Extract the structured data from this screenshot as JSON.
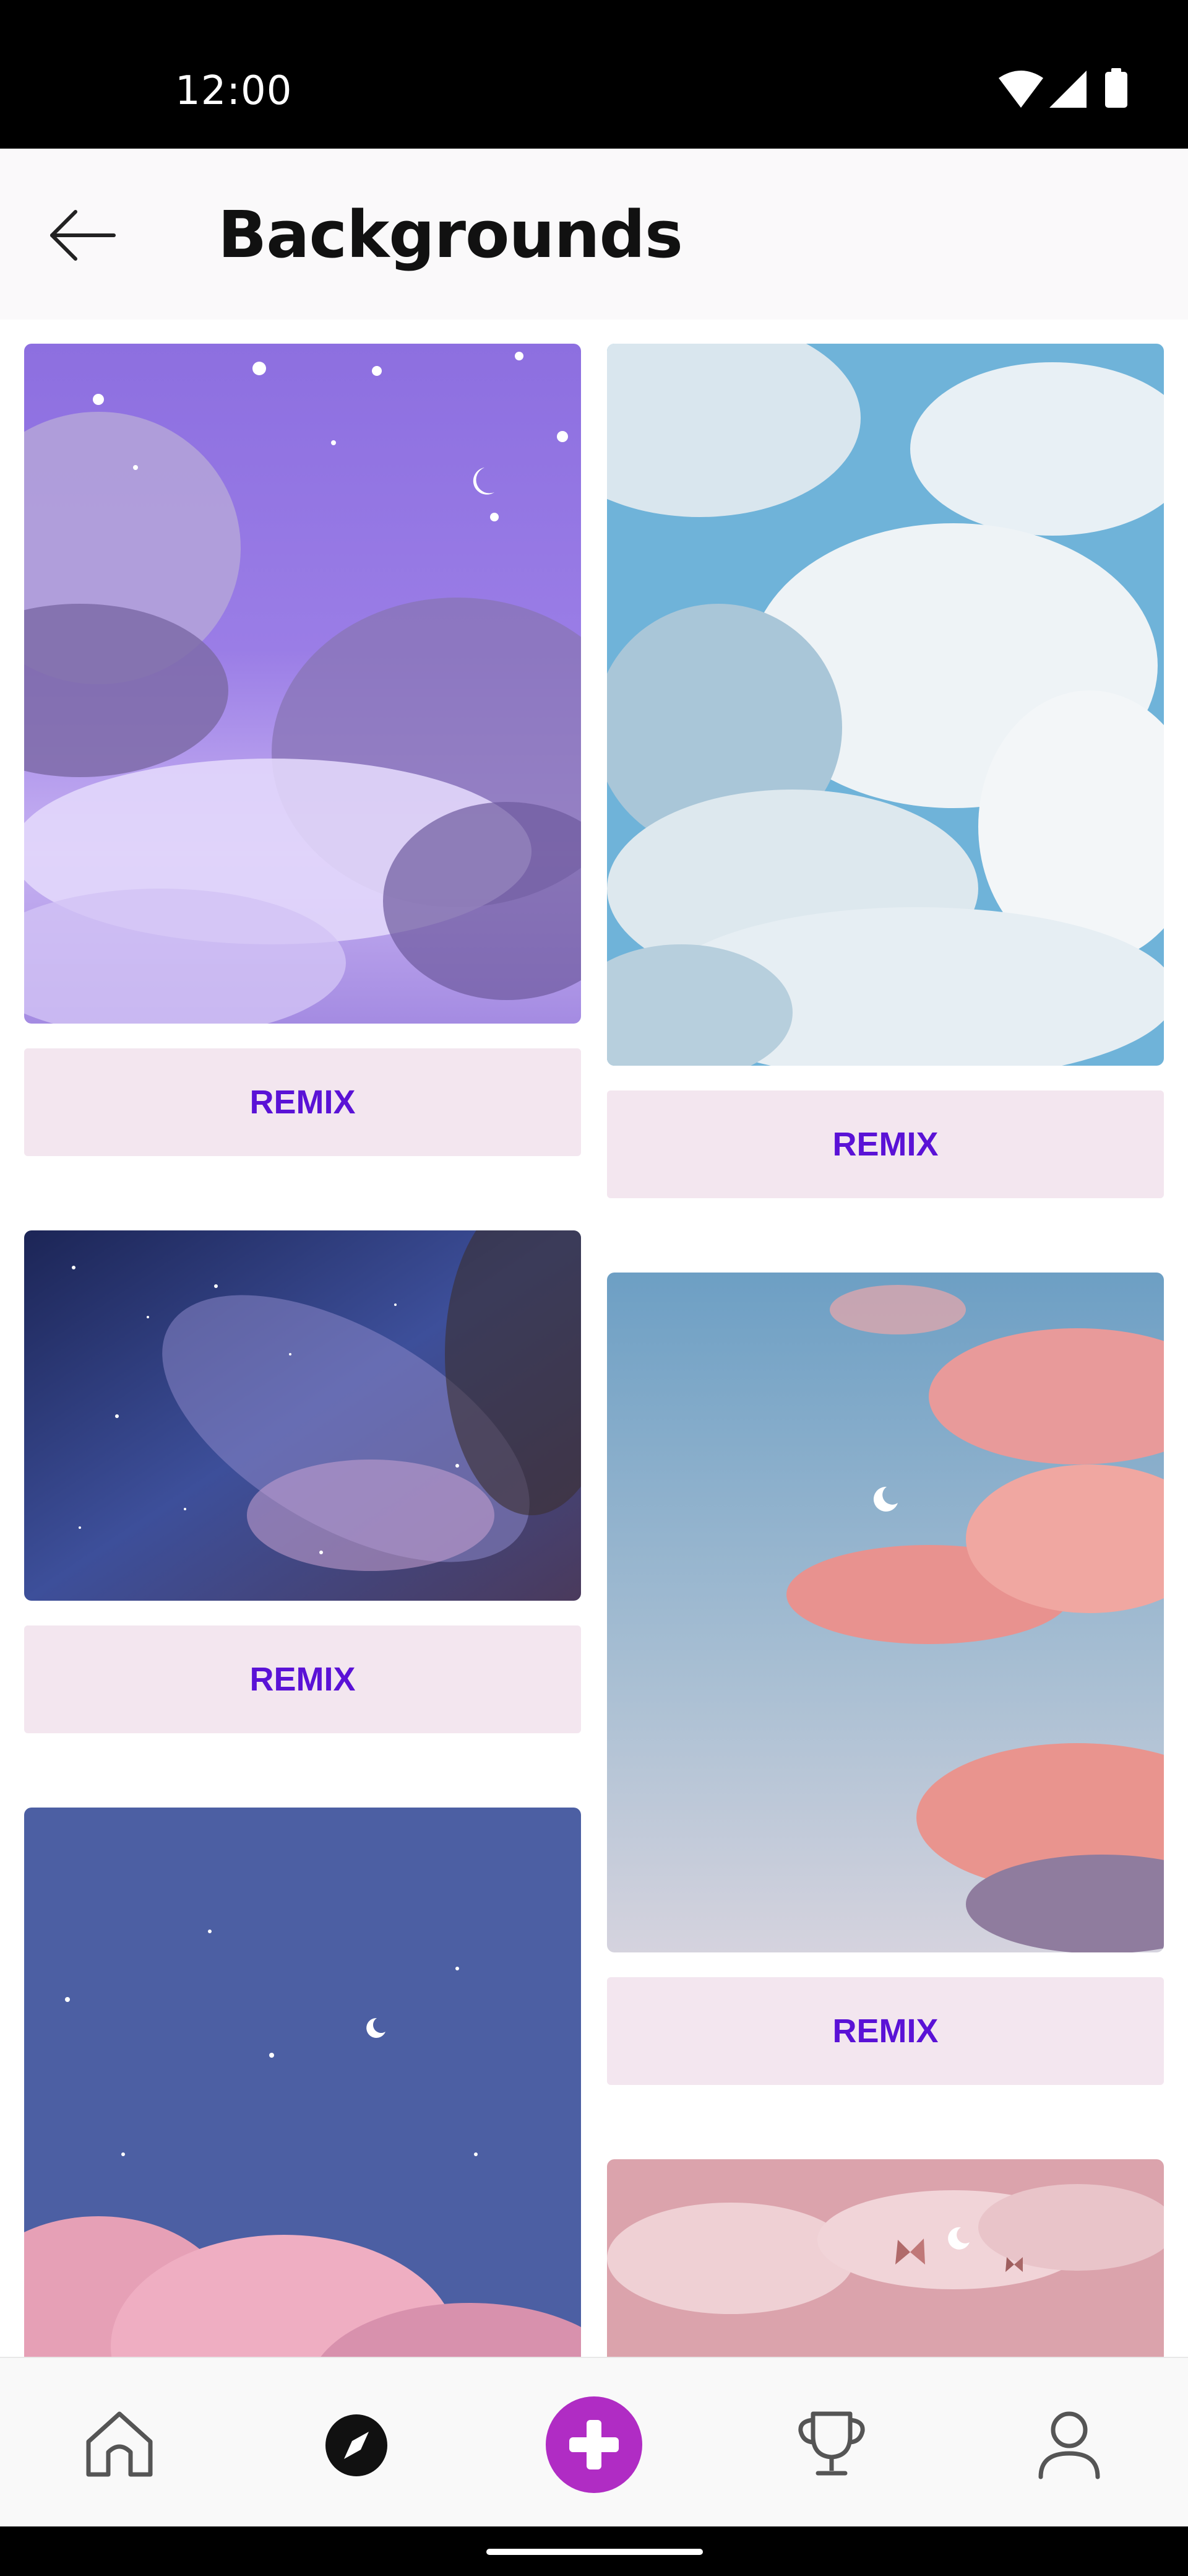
{
  "status_bar": {
    "time": "12:00",
    "icons": [
      "wifi-icon",
      "signal-icon",
      "battery-icon"
    ]
  },
  "header": {
    "back_icon": "arrow-left-icon",
    "title": "Backgrounds"
  },
  "backgrounds": [
    {
      "name": "purple starry clouds",
      "remix_label": "REMIX"
    },
    {
      "name": "blue sky clouds",
      "remix_label": "REMIX"
    },
    {
      "name": "galaxy night sky",
      "remix_label": "REMIX"
    },
    {
      "name": "pink clouds crescent moon",
      "remix_label": "REMIX"
    },
    {
      "name": "night sky pink clouds",
      "remix_label": null
    },
    {
      "name": "pink clouds butterflies",
      "remix_label": null
    }
  ],
  "bottom_nav": {
    "items": [
      "home-icon",
      "explore-icon",
      "create-icon",
      "trophy-icon",
      "profile-icon"
    ],
    "accent_color": "#b02cc4",
    "active": "explore-icon"
  },
  "colors": {
    "remix_button_bg": "#f3e6ef",
    "remix_button_text": "#5a12d6"
  }
}
